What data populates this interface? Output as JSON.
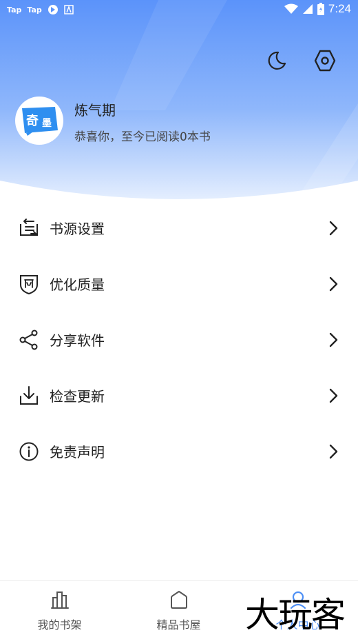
{
  "status_bar": {
    "left_items": [
      "Tap",
      "Tap"
    ],
    "time": "7:24"
  },
  "profile": {
    "avatar_text_1": "奇",
    "avatar_text_2": "墨",
    "level": "炼气期",
    "subtitle": "恭喜你，至今已阅读0本书"
  },
  "menu": [
    {
      "label": "书源设置",
      "icon": "book-source-icon"
    },
    {
      "label": "优化质量",
      "icon": "shield-icon"
    },
    {
      "label": "分享软件",
      "icon": "share-icon"
    },
    {
      "label": "检查更新",
      "icon": "download-icon"
    },
    {
      "label": "免责声明",
      "icon": "info-icon"
    }
  ],
  "bottom_nav": [
    {
      "label": "我的书架",
      "active": false
    },
    {
      "label": "精品书屋",
      "active": false
    },
    {
      "label": "个人中心",
      "active": true
    }
  ],
  "watermark": "大玩客",
  "colors": {
    "header_top": "#5b93fa",
    "header_bottom": "#dde9fd",
    "accent": "#4d8ff5"
  }
}
